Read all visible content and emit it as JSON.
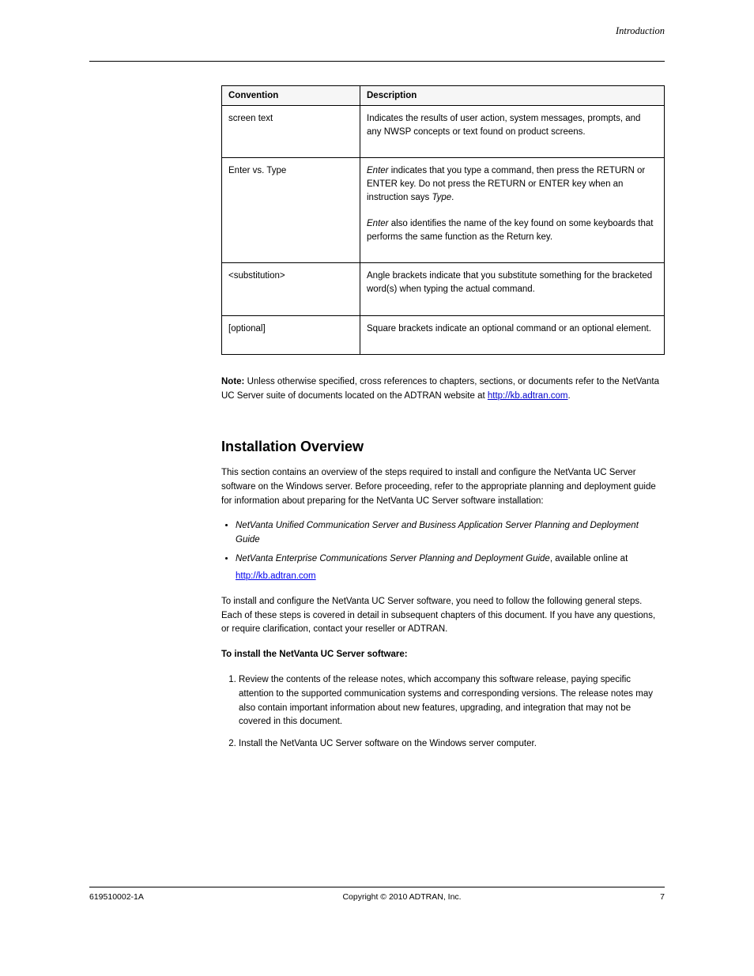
{
  "header": {
    "right": "Introduction"
  },
  "table": {
    "headers": [
      "Convention",
      "Description"
    ],
    "rows": [
      {
        "key": "screen text",
        "key_class": "mono",
        "desc": "Indicates the results of user action, system messages, prompts, and any NWSP concepts or text found on product screens."
      },
      {
        "key": "Enter vs. Type",
        "desc_html": "<span class=\"ital\">Enter</span> indicates that you type a command, then press the RETURN or ENTER key. Do not press the RETURN or ENTER key when an instruction says <span class=\"ital\">Type</span>.<br><br><span class=\"ital\">Enter</span> also identifies the name of the key found on some keyboards that performs the same function as the Return key."
      },
      {
        "key": "<substitution>",
        "desc": "Angle brackets indicate that you substitute something for the bracketed word(s) when typing the actual command."
      },
      {
        "key": "[optional]",
        "desc": "Square brackets indicate an optional command or an optional element."
      }
    ]
  },
  "note": {
    "bold_label": "Note:",
    "text_before": " Unless otherwise specified, cross references to chapters, sections, or documents refer to the ",
    "link_text": "NetVanta UC Server suite",
    "text_middle": " of documents located on the ADTRAN website at ",
    "link2_text": "http://kb.adtran.com",
    "text_after": "."
  },
  "section": {
    "heading": "Installation Overview",
    "p1": "This section contains an overview of the steps required to install and configure the NetVanta UC Server software on the Windows server. Before proceeding, refer to the appropriate planning and deployment guide for information about preparing for the NetVanta UC Server software installation:",
    "bullets": [
      {
        "ital": "NetVanta Unified Communication Server and Business Application Server Planning and Deployment Guide",
        "rest": ""
      },
      {
        "ital": "NetVanta Enterprise Communications Server Planning and Deployment Guide",
        "rest": ", available online at"
      }
    ],
    "link_line_href": "http://kb.adtran.com",
    "link_line_text": "http://kb.adtran.com",
    "p2": "To install and configure the NetVanta UC Server software, you need to follow the following general steps. Each of these steps is covered in detail in subsequent chapters of this document. If you have any questions, or require clarification, contact your reseller or ADTRAN.",
    "steps_label": "To install the NetVanta UC Server software:",
    "steps": [
      "Review the contents of the release notes, which accompany this software release, paying specific attention to the supported communication systems and corresponding versions. The release notes may also contain important information about new features, upgrading, and integration that may not be covered in this document.",
      "Install the NetVanta UC Server software on the Windows server computer."
    ]
  },
  "footer": {
    "left": "619510002-1A",
    "center": "Copyright © 2010 ADTRAN, Inc.",
    "right": "7"
  }
}
